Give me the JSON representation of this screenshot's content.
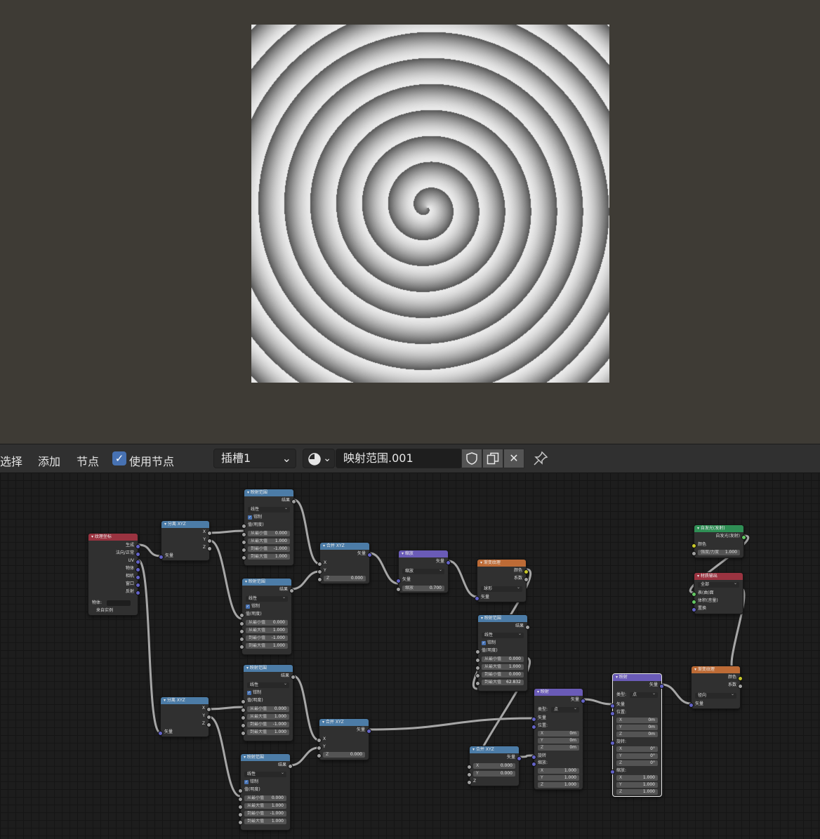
{
  "toolbar": {
    "menu_select": "选择",
    "menu_add": "添加",
    "menu_node": "节点",
    "use_nodes_label": "使用节点",
    "use_nodes_checked": true,
    "slot": "插槽1",
    "data_name": "映射范围.001",
    "icons": [
      "checkbox-icon",
      "chevron-down-icon",
      "texture-type-icon",
      "shield-icon",
      "duplicate-icon",
      "close-icon",
      "pin-icon"
    ]
  },
  "viewport": {
    "bg_color": "#3e3b35",
    "content": "spiral-texture-preview"
  },
  "nodes": {
    "texcoord": {
      "title": "纹理坐标",
      "outputs": [
        "生成",
        "法向/正常",
        "UV",
        "物体",
        "相机",
        "窗口",
        "反射"
      ],
      "object_label": "物体:",
      "from_instancer": "来自实例"
    },
    "sep1": {
      "title": "分离 XYZ",
      "outputs": [
        "X",
        "Y",
        "Z"
      ],
      "input": "矢量"
    },
    "sep2": {
      "title": "分离 XYZ",
      "outputs": [
        "X",
        "Y",
        "Z"
      ],
      "input": "矢量"
    },
    "map1": {
      "title": "映射范围",
      "out": "结果",
      "mode": "线性",
      "clamp": "钳制",
      "value": "值(明度)",
      "fields": [
        [
          "从最小值",
          "0.000"
        ],
        [
          "从最大值",
          "1.000"
        ],
        [
          "到最小值",
          "-1.000"
        ],
        [
          "到最大值",
          "1.000"
        ]
      ]
    },
    "map2": {
      "title": "映射范围",
      "out": "结果",
      "mode": "线性",
      "clamp": "钳制",
      "value": "值(明度)",
      "fields": [
        [
          "从最小值",
          "0.000"
        ],
        [
          "从最大值",
          "1.000"
        ],
        [
          "到最小值",
          "-1.000"
        ],
        [
          "到最大值",
          "1.000"
        ]
      ]
    },
    "map3": {
      "title": "映射范围",
      "out": "结果",
      "mode": "线性",
      "clamp": "钳制",
      "value": "值(明度)",
      "fields": [
        [
          "从最小值",
          "0.000"
        ],
        [
          "从最大值",
          "1.000"
        ],
        [
          "到最小值",
          "-1.000"
        ],
        [
          "到最大值",
          "1.000"
        ]
      ]
    },
    "map4": {
      "title": "映射范围",
      "out": "结果",
      "mode": "线性",
      "clamp": "钳制",
      "value": "值(明度)",
      "fields": [
        [
          "从最小值",
          "0.000"
        ],
        [
          "从最大值",
          "1.000"
        ],
        [
          "到最小值",
          "-1.000"
        ],
        [
          "到最大值",
          "1.000"
        ]
      ]
    },
    "map5": {
      "title": "映射范围",
      "out": "结果",
      "mode": "线性",
      "clamp": "钳制",
      "value": "值(明度)",
      "fields": [
        [
          "从最小值",
          "0.000"
        ],
        [
          "从最大值",
          "1.000"
        ],
        [
          "到最小值",
          "0.000"
        ],
        [
          "到最大值",
          "62.832"
        ]
      ]
    },
    "comb1": {
      "title": "合并 XYZ",
      "out": "矢量",
      "inputs": [
        "X",
        "Y"
      ],
      "z_label": "Z",
      "z_value": "0.000"
    },
    "comb2": {
      "title": "合并 XYZ",
      "out": "矢量",
      "inputs": [
        "X",
        "Y"
      ],
      "z_label": "Z",
      "z_value": "0.000"
    },
    "comb3": {
      "title": "合并 XYZ",
      "out": "矢量",
      "x_label": "X",
      "x_value": "0.000",
      "y_label": "Y",
      "y_value": "0.000",
      "z_label": "Z"
    },
    "scale": {
      "title": "缩放",
      "out": "矢量",
      "mode": "缩放",
      "input": "矢量",
      "scale_label": "缩放",
      "scale_value": "0.700"
    },
    "grad1": {
      "title": "渐变纹理",
      "out_color": "颜色",
      "out_fac": "系数",
      "mode": "球形",
      "input": "矢量"
    },
    "grad2": {
      "title": "渐变纹理",
      "out_color": "颜色",
      "out_fac": "系数",
      "mode": "径向",
      "input": "矢量"
    },
    "mapping1": {
      "title": "映射",
      "out": "矢量",
      "type_label": "类型:",
      "type_value": "点",
      "input": "矢量",
      "loc_label": "位置:",
      "loc": [
        [
          "X",
          "0m"
        ],
        [
          "Y",
          "0m"
        ],
        [
          "Z",
          "0m"
        ]
      ],
      "rot_label": "旋转",
      "scale_label": "缩放:",
      "scale": [
        [
          "X",
          "1.000"
        ],
        [
          "Y",
          "1.000"
        ],
        [
          "Z",
          "1.000"
        ]
      ]
    },
    "mapping2": {
      "title": "映射",
      "out": "矢量",
      "type_label": "类型:",
      "type_value": "点",
      "input": "矢量",
      "loc_label": "位置:",
      "loc": [
        [
          "X",
          "0m"
        ],
        [
          "Y",
          "0m"
        ],
        [
          "Z",
          "0m"
        ]
      ],
      "rot_label": "旋转:",
      "rot": [
        [
          "X",
          "0°"
        ],
        [
          "Y",
          "0°"
        ],
        [
          "Z",
          "0°"
        ]
      ],
      "scale_label": "缩放:",
      "scale": [
        [
          "X",
          "1.000"
        ],
        [
          "Y",
          "1.000"
        ],
        [
          "Z",
          "1.000"
        ]
      ]
    },
    "emission": {
      "title": "自发光(发射)",
      "out": "自发光(发射)",
      "color_label": "颜色",
      "strength_label": "强度/力度",
      "strength_value": "1.000"
    },
    "output": {
      "title": "材质输出",
      "target": "全部",
      "inputs": [
        "表(曲)面",
        "体积(音量)",
        "置换"
      ]
    }
  },
  "colors": {
    "accent": "#4772b3",
    "header_input": "#9a3340",
    "header_vector": "#4c7ca7",
    "header_texture": "#bd6b36",
    "header_shader": "#2f8f55",
    "header_converter": "#6a5bb7",
    "socket_vector": "#6363c7",
    "socket_float": "#a1a1a1",
    "socket_color": "#c7c729",
    "socket_shader": "#63c763"
  }
}
